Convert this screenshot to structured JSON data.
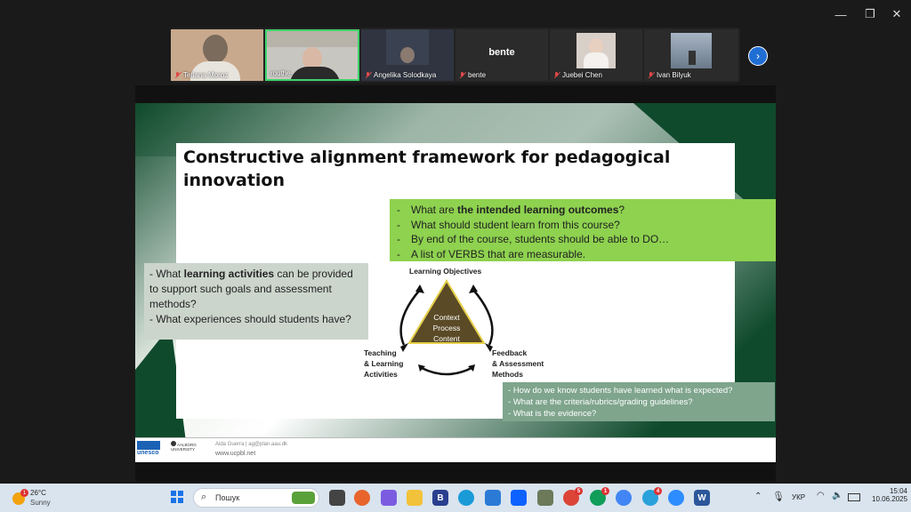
{
  "participants": [
    {
      "name": "Tetiana Moroz",
      "bg": "#c9a98d"
    },
    {
      "name": "routhe",
      "bg": "#c8c6c0",
      "active": true
    },
    {
      "name": "Angelika Solodkaya",
      "bg": "#2f3440"
    },
    {
      "name": "bente",
      "bg": "#2b2b2b",
      "avatar_text": "bente"
    },
    {
      "name": "Juebei Chen",
      "bg": "#d8cfc9"
    },
    {
      "name": "Ivan Bilyuk",
      "bg": "#8a9bb0"
    }
  ],
  "slide": {
    "title": "Constructive alignment framework for pedagogical innovation",
    "outcomes": [
      {
        "pre": "What are ",
        "bold": "the intended learning outcomes",
        "post": "?"
      },
      {
        "pre": "What should student learn from this course?",
        "bold": "",
        "post": ""
      },
      {
        "pre": "By end of the course, students should be able to DO…",
        "bold": "",
        "post": ""
      },
      {
        "pre": "A list of VERBS that are measurable.",
        "bold": "",
        "post": ""
      }
    ],
    "activities": {
      "l1_pre": "- What ",
      "l1_bold": "learning activities",
      "l1_post": " can be provided to support such goals and assessment methods?",
      "l2": "- What experiences should students have?"
    },
    "diagram": {
      "top": "Learning Objectives",
      "left_1": "Teaching",
      "left_2": "& Learning",
      "left_3": "Activities",
      "right_1": "Feedback",
      "right_2": "& Assessment",
      "right_3": "Methods",
      "center_1": "Context",
      "center_2": "Process",
      "center_3": "Content"
    },
    "feedback": [
      "How do we know students have learned what is expected?",
      "What are the criteria/rubrics/grading guidelines?",
      "What is the evidence?"
    ],
    "footer": {
      "unesco": "unesco",
      "aalborg": "AALBORG UNIVERSITY",
      "author": "Aida Guerra | ag@plan.aau.dk",
      "url": "www.ucpbl.net"
    }
  },
  "taskbar": {
    "weather_temp": "26°C",
    "weather_desc": "Sunny",
    "weather_badge": "1",
    "search_placeholder": "Пошук",
    "lang": "УКР",
    "time": "15:04",
    "date": "10.06.2025"
  },
  "colors": {
    "slide_green": "#8ed24f",
    "dark_green": "#0f4a2c",
    "feedback_box": "#7fa58d"
  }
}
